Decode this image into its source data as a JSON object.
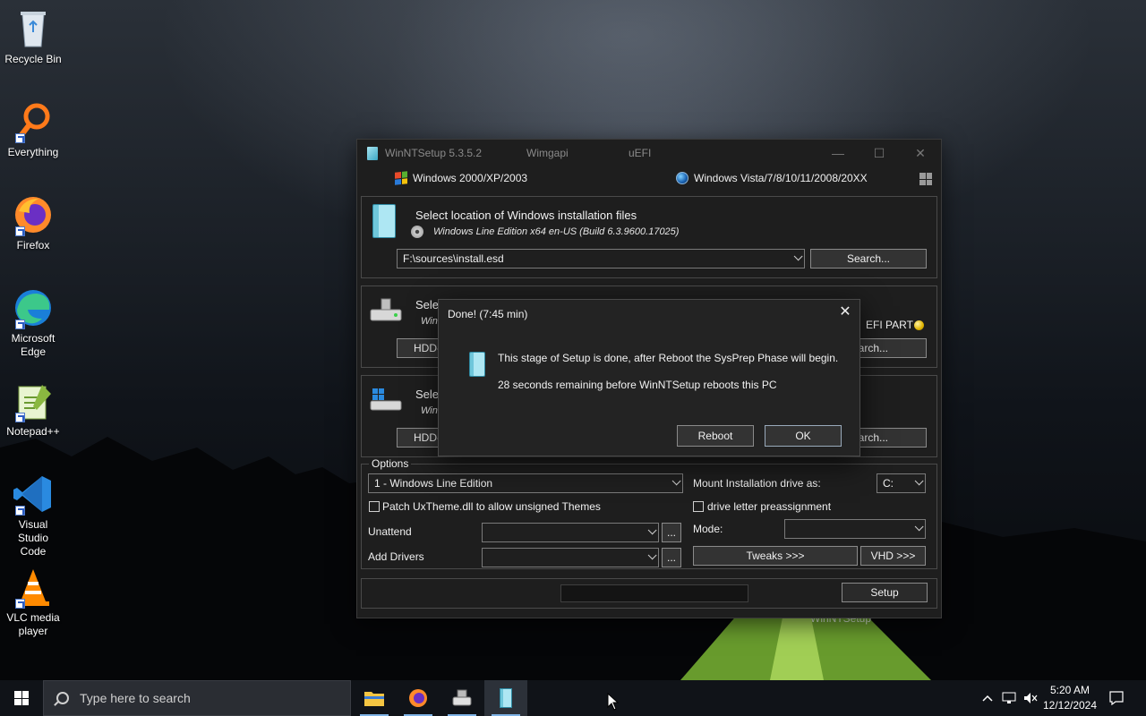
{
  "desktop": {
    "icons": [
      {
        "label": "Recycle Bin"
      },
      {
        "label": "Everything"
      },
      {
        "label": "Firefox"
      },
      {
        "label": "Microsoft Edge"
      },
      {
        "label": "Notepad++"
      },
      {
        "label": "Visual Studio Code"
      },
      {
        "label": "VLC media player"
      }
    ],
    "background_label": "WinNTSetup"
  },
  "main_window": {
    "title": "WinNTSetup 5.3.5.2",
    "title_wimgapi": "Wimgapi",
    "title_uefi": "uEFI",
    "os_left": "Windows 2000/XP/2003",
    "os_right": "Windows Vista/7/8/10/11/2008/20XX",
    "source": {
      "heading": "Select location of Windows installation files",
      "info": "Windows Line Edition  x64 en-US (Build 6.3.9600.17025)",
      "path": "F:\\sources\\install.esd",
      "search_label": "Search..."
    },
    "boot": {
      "heading": "Selec",
      "sub": "Wind",
      "drive_label": "HDD-",
      "efi_label": "EFI PART",
      "search_label": "earch..."
    },
    "install": {
      "heading": "Selec",
      "sub": "Wind",
      "drive_label": "HDD-",
      "search_label": "earch..."
    },
    "options": {
      "legend": "Options",
      "edition": "1 - Windows Line Edition",
      "patch_uxtheme": "Patch UxTheme.dll to allow unsigned Themes",
      "unattend_label": "Unattend",
      "add_drivers_label": "Add Drivers",
      "browse_label": "...",
      "mount_label": "Mount Installation drive as:",
      "mount_value": "C:",
      "drive_letter_label": "drive letter preassignment",
      "mode_label": "Mode:",
      "tweaks_label": "Tweaks >>>",
      "vhd_label": "VHD >>>"
    },
    "setup_label": "Setup"
  },
  "dialog": {
    "title": "Done! (7:45 min)",
    "message1": "This stage of Setup is done, after Reboot the SysPrep Phase will begin.",
    "message2": "28 seconds remaining before WinNTSetup reboots this PC",
    "reboot_label": "Reboot",
    "ok_label": "OK",
    "close_glyph": "✕"
  },
  "taskbar": {
    "search_placeholder": "Type here to search",
    "clock_time": "5:20 AM",
    "clock_date": "12/12/2024"
  }
}
